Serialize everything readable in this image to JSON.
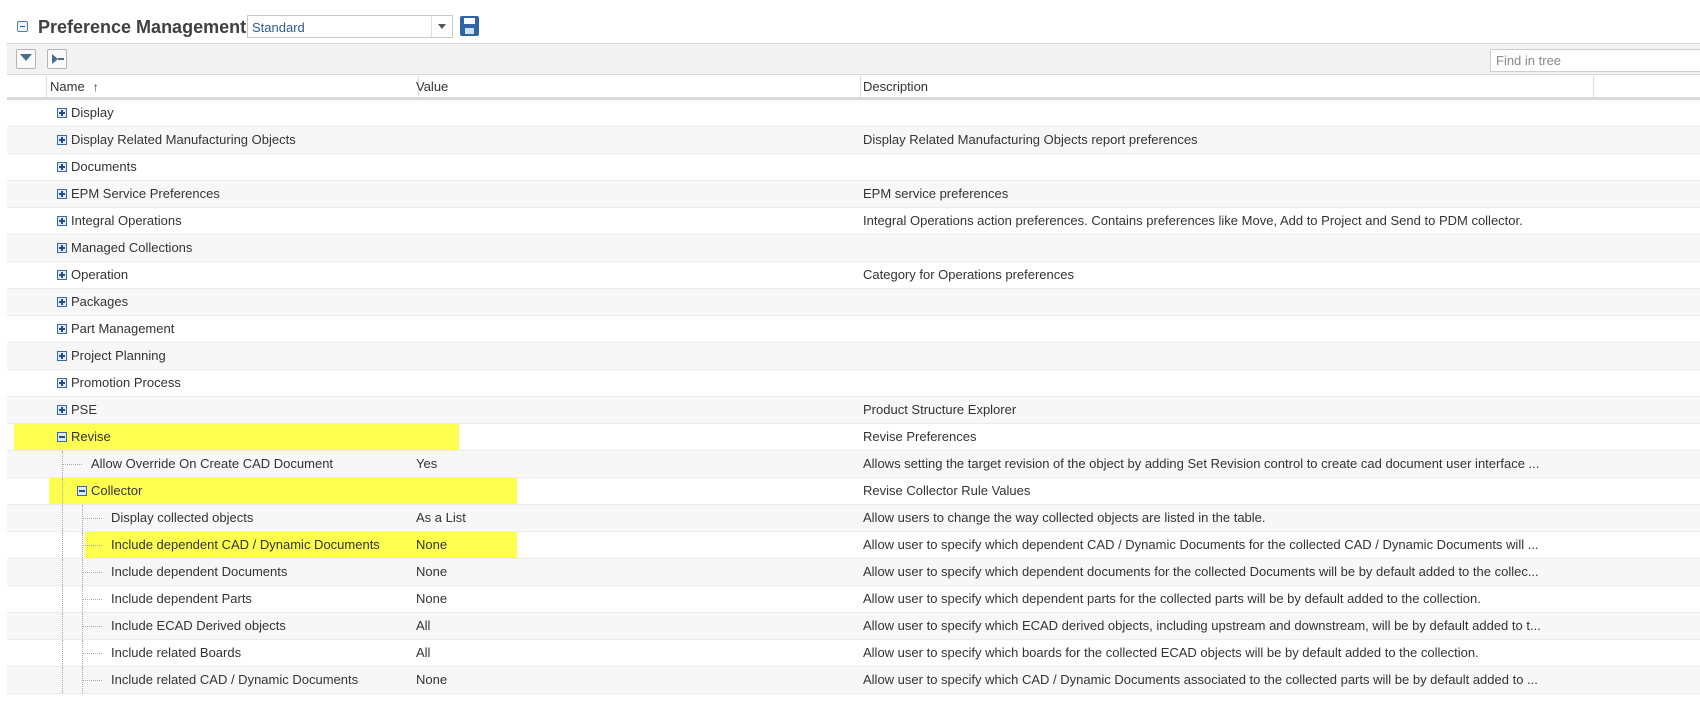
{
  "header": {
    "title": "Preference Management",
    "view_select": "Standard"
  },
  "toolbar": {
    "find_placeholder": "Find in tree"
  },
  "columns": {
    "name": "Name",
    "value": "Value",
    "description": "Description",
    "sort_indicator": "↑"
  },
  "colors": {
    "highlight": "#ffff4f",
    "select_text": "#2b5d94",
    "tree_icon": "#3d6b9f"
  },
  "rows": [
    {
      "name": "Display",
      "value": "",
      "description": ""
    },
    {
      "name": "Display Related Manufacturing Objects",
      "value": "",
      "description": "Display Related Manufacturing Objects report preferences"
    },
    {
      "name": "Documents",
      "value": "",
      "description": ""
    },
    {
      "name": "EPM Service Preferences",
      "value": "",
      "description": "EPM service preferences"
    },
    {
      "name": "Integral Operations",
      "value": "",
      "description": "Integral Operations action preferences. Contains preferences like Move, Add to Project and Send to PDM collector."
    },
    {
      "name": "Managed Collections",
      "value": "",
      "description": ""
    },
    {
      "name": "Operation",
      "value": "",
      "description": "Category for Operations preferences"
    },
    {
      "name": "Packages",
      "value": "",
      "description": ""
    },
    {
      "name": "Part Management",
      "value": "",
      "description": ""
    },
    {
      "name": "Project Planning",
      "value": "",
      "description": ""
    },
    {
      "name": "Promotion Process",
      "value": "",
      "description": ""
    },
    {
      "name": "PSE",
      "value": "",
      "description": "Product Structure Explorer"
    },
    {
      "name": "Revise",
      "value": "",
      "description": "Revise Preferences"
    },
    {
      "name": "Allow Override On Create CAD Document",
      "value": "Yes",
      "description": "Allows setting the target revision of the object by adding Set Revision control to create cad document user interface ..."
    },
    {
      "name": "Collector",
      "value": "",
      "description": "Revise Collector Rule Values"
    },
    {
      "name": "Display collected objects",
      "value": "As a List",
      "description": "Allow users to change the way collected objects are listed in the table."
    },
    {
      "name": "Include dependent CAD / Dynamic Documents",
      "value": "None",
      "description": "Allow user to specify which dependent CAD / Dynamic Documents for the collected CAD / Dynamic Documents will ..."
    },
    {
      "name": "Include dependent Documents",
      "value": "None",
      "description": "Allow user to specify which dependent documents for the collected Documents will be by default added to the collec..."
    },
    {
      "name": "Include dependent Parts",
      "value": "None",
      "description": "Allow user to specify which dependent parts for the collected parts will be by default added to the collection."
    },
    {
      "name": "Include ECAD Derived objects",
      "value": "All",
      "description": "Allow user to specify which ECAD derived objects, including upstream and downstream, will be by default added to t..."
    },
    {
      "name": "Include related Boards",
      "value": "All",
      "description": "Allow user to specify which boards for the collected ECAD objects will be by default added to the collection."
    },
    {
      "name": "Include related CAD / Dynamic Documents",
      "value": "None",
      "description": "Allow user to specify which CAD / Dynamic Documents associated to the collected parts will be by default added to ..."
    }
  ]
}
